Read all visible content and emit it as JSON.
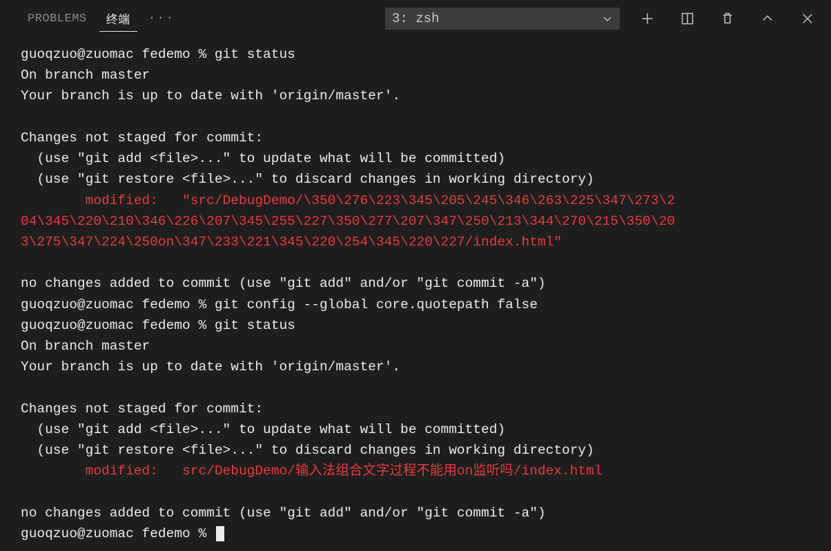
{
  "panel": {
    "tabs": {
      "problems": "PROBLEMS",
      "terminal": "终端"
    },
    "select": {
      "label": "3: zsh"
    }
  },
  "term": {
    "l1": "guoqzuo@zuomac fedemo % git status",
    "l2": "On branch master",
    "l3": "Your branch is up to date with 'origin/master'.",
    "l4": "",
    "l5": "Changes not staged for commit:",
    "l6": "  (use \"git add <file>...\" to update what will be committed)",
    "l7": "  (use \"git restore <file>...\" to discard changes in working directory)",
    "l8a": "        modified:   \"src/DebugDemo/\\350\\276\\223\\345\\205\\245\\346\\263\\225\\347\\273\\2",
    "l8b": "04\\345\\220\\210\\346\\226\\207\\345\\255\\227\\350\\277\\207\\347\\250\\213\\344\\270\\215\\350\\20",
    "l8c": "3\\275\\347\\224\\250on\\347\\233\\221\\345\\220\\254\\345\\220\\227/index.html\"",
    "l9": "",
    "l10": "no changes added to commit (use \"git add\" and/or \"git commit -a\")",
    "l11": "guoqzuo@zuomac fedemo % git config --global core.quotepath false",
    "l12": "guoqzuo@zuomac fedemo % git status",
    "l13": "On branch master",
    "l14": "Your branch is up to date with 'origin/master'.",
    "l15": "",
    "l16": "Changes not staged for commit:",
    "l17": "  (use \"git add <file>...\" to update what will be committed)",
    "l18": "  (use \"git restore <file>...\" to discard changes in working directory)",
    "l19": "        modified:   src/DebugDemo/输入法组合文字过程不能用on监听吗/index.html",
    "l20": "",
    "l21": "no changes added to commit (use \"git add\" and/or \"git commit -a\")",
    "l22": "guoqzuo@zuomac fedemo % "
  }
}
